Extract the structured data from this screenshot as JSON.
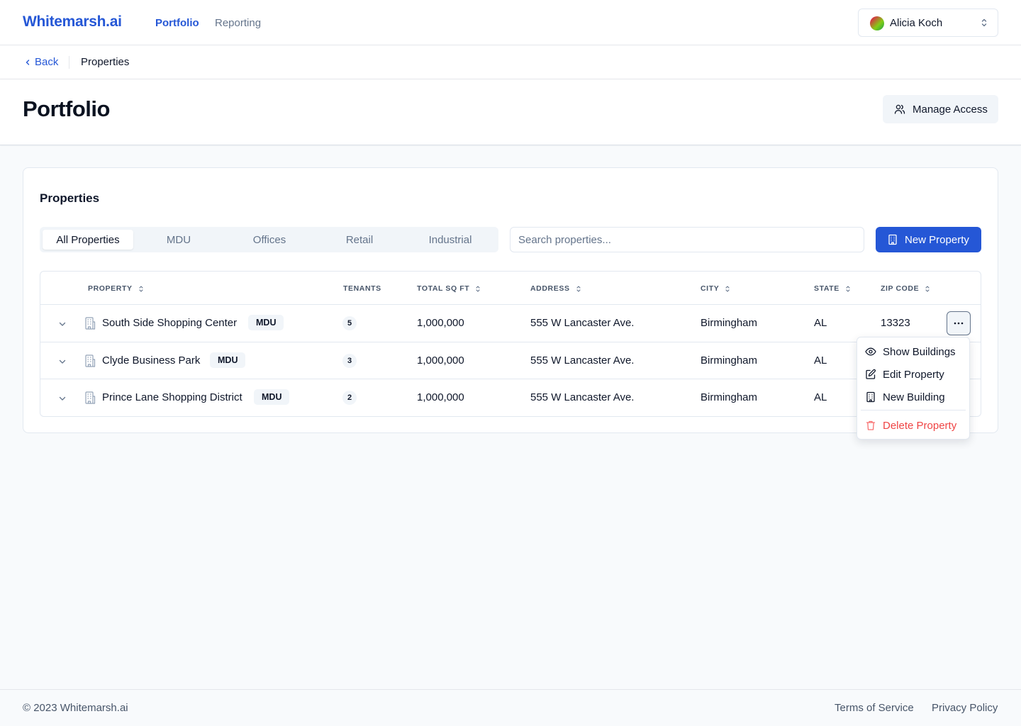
{
  "app": {
    "logo": "Whitemarsh.ai"
  },
  "nav": {
    "items": [
      {
        "label": "Portfolio",
        "active": true
      },
      {
        "label": "Reporting",
        "active": false
      }
    ]
  },
  "user": {
    "name": "Alicia Koch"
  },
  "breadcrumb": {
    "back_label": "Back",
    "current": "Properties"
  },
  "page": {
    "title": "Portfolio",
    "manage_access_label": "Manage Access"
  },
  "properties_card": {
    "title": "Properties",
    "tabs": [
      {
        "label": "All Properties",
        "active": true
      },
      {
        "label": "MDU",
        "active": false
      },
      {
        "label": "Offices",
        "active": false
      },
      {
        "label": "Retail",
        "active": false
      },
      {
        "label": "Industrial",
        "active": false
      }
    ],
    "search_placeholder": "Search properties...",
    "new_property_label": "New Property",
    "columns": {
      "property": "PROPERTY",
      "tenants": "TENANTS",
      "total_sq_ft": "TOTAL SQ FT",
      "address": "ADDRESS",
      "city": "CITY",
      "state": "STATE",
      "zip": "ZIP CODE"
    },
    "rows": [
      {
        "name": "South Side Shopping Center",
        "type": "MDU",
        "tenants": "5",
        "sqft": "1,000,000",
        "address": "555 W Lancaster Ave.",
        "city": "Birmingham",
        "state": "AL",
        "zip": "13323"
      },
      {
        "name": "Clyde Business Park",
        "type": "MDU",
        "tenants": "3",
        "sqft": "1,000,000",
        "address": "555 W Lancaster Ave.",
        "city": "Birmingham",
        "state": "AL",
        "zip": ""
      },
      {
        "name": "Prince Lane Shopping District",
        "type": "MDU",
        "tenants": "2",
        "sqft": "1,000,000",
        "address": "555 W Lancaster Ave.",
        "city": "Birmingham",
        "state": "AL",
        "zip": ""
      }
    ]
  },
  "row_menu": {
    "items": [
      {
        "label": "Show Buildings",
        "icon": "eye-icon"
      },
      {
        "label": "Edit Property",
        "icon": "edit-icon"
      },
      {
        "label": "New Building",
        "icon": "building-icon"
      },
      {
        "label": "Delete Property",
        "icon": "trash-icon"
      }
    ]
  },
  "footer": {
    "copyright": "© 2023 Whitemarsh.ai",
    "terms": "Terms of Service",
    "privacy": "Privacy Policy"
  },
  "colors": {
    "brand": "#2557d6",
    "danger": "#ef4444",
    "muted": "#64748b"
  }
}
